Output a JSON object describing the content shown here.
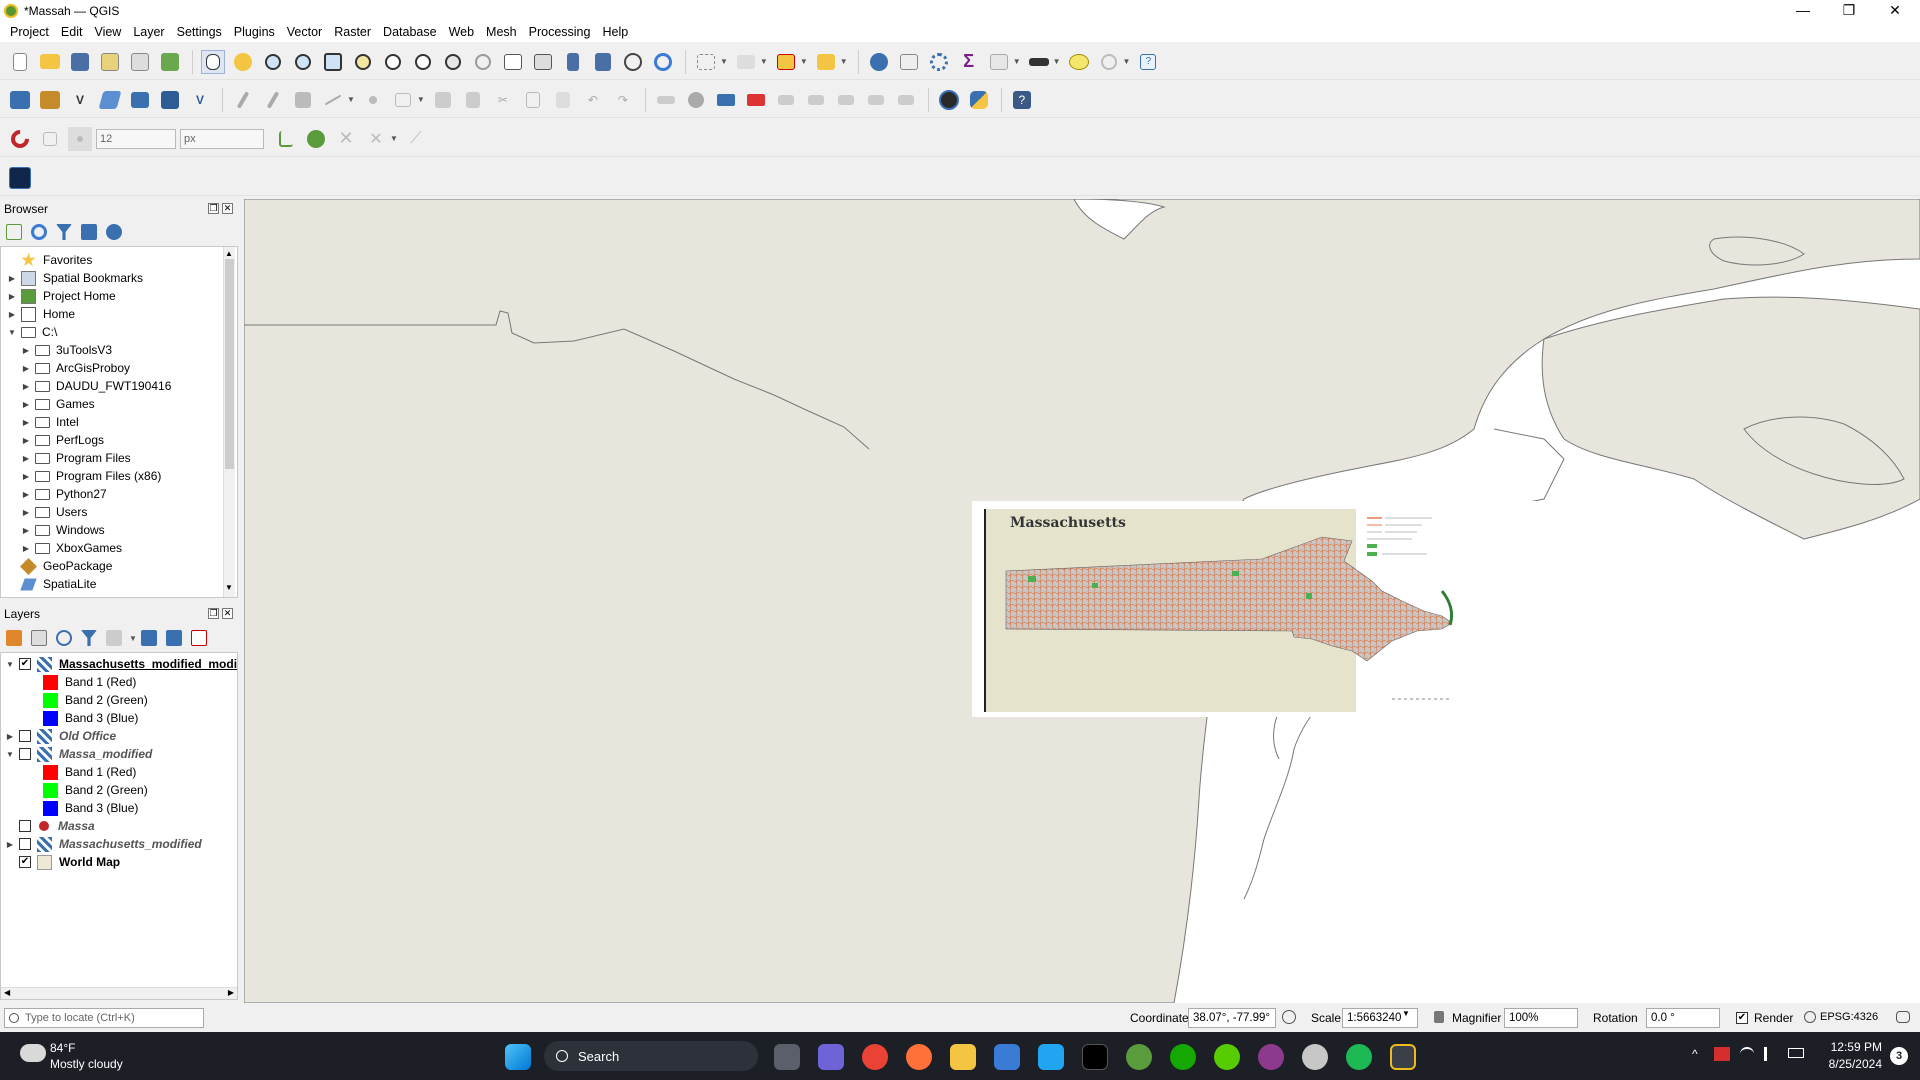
{
  "window": {
    "title": "*Massah — QGIS",
    "minimize": "—",
    "maximize": "❐",
    "close": "✕"
  },
  "menu": [
    "Project",
    "Edit",
    "View",
    "Layer",
    "Settings",
    "Plugins",
    "Vector",
    "Raster",
    "Database",
    "Web",
    "Mesh",
    "Processing",
    "Help"
  ],
  "snapping": {
    "tolerance_value": "12",
    "unit": "px"
  },
  "browser": {
    "title": "Browser",
    "items": [
      {
        "label": "Favorites",
        "level": 0,
        "arrow": "",
        "icon": "star-icon"
      },
      {
        "label": "Spatial Bookmarks",
        "level": 0,
        "arrow": "▶",
        "icon": "bookmark-icon"
      },
      {
        "label": "Project Home",
        "level": 0,
        "arrow": "▶",
        "icon": "project-home-icon"
      },
      {
        "label": "Home",
        "level": 0,
        "arrow": "▶",
        "icon": "home-folder-icon"
      },
      {
        "label": "C:\\",
        "level": 0,
        "arrow": "▼",
        "icon": "drive-icon"
      },
      {
        "label": "3uToolsV3",
        "level": 1,
        "arrow": "▶",
        "icon": "folder-icon"
      },
      {
        "label": "ArcGisProboy",
        "level": 1,
        "arrow": "▶",
        "icon": "folder-icon"
      },
      {
        "label": "DAUDU_FWT190416",
        "level": 1,
        "arrow": "▶",
        "icon": "folder-icon"
      },
      {
        "label": "Games",
        "level": 1,
        "arrow": "▶",
        "icon": "folder-icon"
      },
      {
        "label": "Intel",
        "level": 1,
        "arrow": "▶",
        "icon": "folder-icon"
      },
      {
        "label": "PerfLogs",
        "level": 1,
        "arrow": "▶",
        "icon": "folder-icon"
      },
      {
        "label": "Program Files",
        "level": 1,
        "arrow": "▶",
        "icon": "folder-icon"
      },
      {
        "label": "Program Files (x86)",
        "level": 1,
        "arrow": "▶",
        "icon": "folder-icon"
      },
      {
        "label": "Python27",
        "level": 1,
        "arrow": "▶",
        "icon": "folder-icon"
      },
      {
        "label": "Users",
        "level": 1,
        "arrow": "▶",
        "icon": "folder-icon"
      },
      {
        "label": "Windows",
        "level": 1,
        "arrow": "▶",
        "icon": "folder-icon"
      },
      {
        "label": "XboxGames",
        "level": 1,
        "arrow": "▶",
        "icon": "folder-icon"
      },
      {
        "label": "GeoPackage",
        "level": 0,
        "arrow": "",
        "icon": "geopackage-icon"
      },
      {
        "label": "SpatiaLite",
        "level": 0,
        "arrow": "",
        "icon": "spatialite-icon"
      }
    ]
  },
  "layers": {
    "title": "Layers",
    "items": [
      {
        "label": "Massachusetts_modified_modi",
        "kind": "raster",
        "checked": true,
        "arrow": "▼",
        "style": "bold-underline"
      },
      {
        "label": "Band 1 (Red)",
        "kind": "band",
        "color": "#ff0000"
      },
      {
        "label": "Band 2 (Green)",
        "kind": "band",
        "color": "#00ff00"
      },
      {
        "label": "Band 3 (Blue)",
        "kind": "band",
        "color": "#0000ff"
      },
      {
        "label": "Old Office",
        "kind": "raster",
        "checked": false,
        "arrow": "▶",
        "style": "italic"
      },
      {
        "label": "Massa_modified",
        "kind": "raster",
        "checked": false,
        "arrow": "▼",
        "style": "italic"
      },
      {
        "label": "Band 1 (Red)",
        "kind": "band",
        "color": "#ff0000"
      },
      {
        "label": "Band 2 (Green)",
        "kind": "band",
        "color": "#00ff00"
      },
      {
        "label": "Band 3 (Blue)",
        "kind": "band",
        "color": "#0000ff"
      },
      {
        "label": "Massa",
        "kind": "point",
        "checked": false,
        "arrow": "",
        "style": "italic"
      },
      {
        "label": "Massachusetts_modified",
        "kind": "raster",
        "checked": false,
        "arrow": "▶",
        "style": "italic"
      },
      {
        "label": "World Map",
        "kind": "vector",
        "checked": true,
        "arrow": "",
        "style": "bold"
      }
    ]
  },
  "locator": {
    "placeholder": "Type to locate (Ctrl+K)"
  },
  "map": {
    "overlay_title": "Massachusetts",
    "land_color": "#e8e6dc",
    "water_color": "#ffffff"
  },
  "status": {
    "coordinate_label": "Coordinate",
    "coordinate_value": "38.07°, -77.99°",
    "scale_label": "Scale",
    "scale_value": "1:5663240",
    "magnifier_label": "Magnifier",
    "magnifier_value": "100%",
    "rotation_label": "Rotation",
    "rotation_value": "0.0 °",
    "render_label": "Render",
    "crs": "EPSG:4326"
  },
  "taskbar": {
    "weather_temp": "84°F",
    "weather_desc": "Mostly cloudy",
    "search_label": "Search",
    "time": "12:59 PM",
    "date": "8/25/2024",
    "notification_count": "3"
  }
}
